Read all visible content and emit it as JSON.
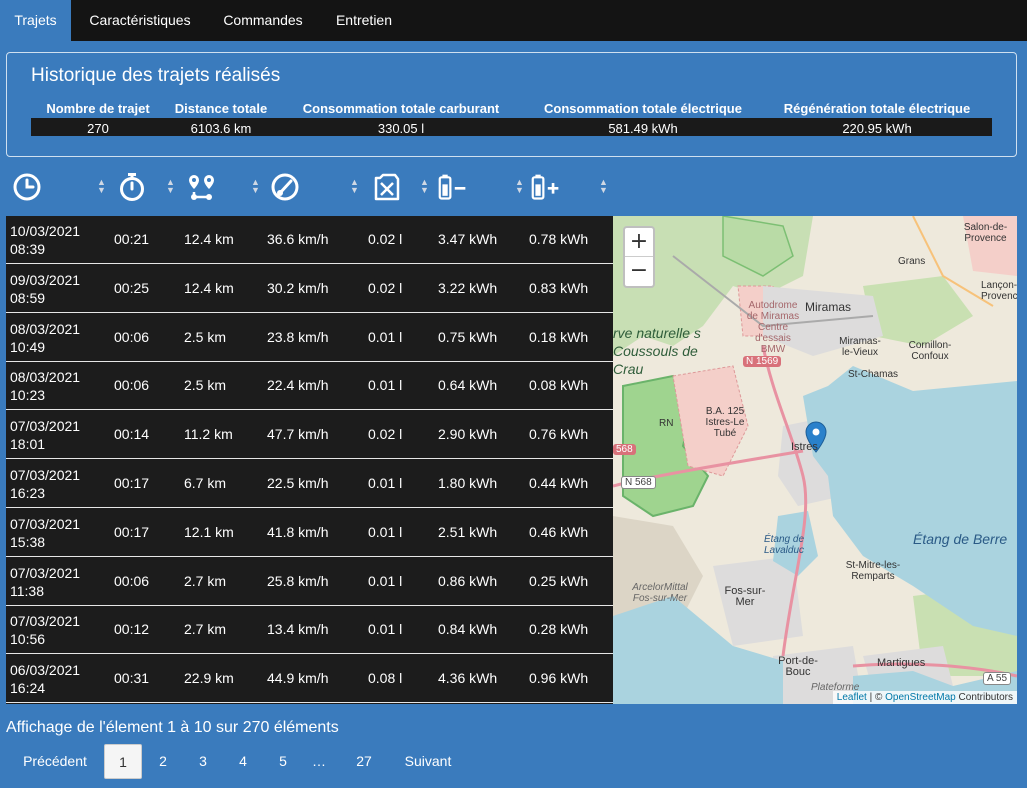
{
  "nav": {
    "tabs": [
      {
        "label": "Trajets",
        "active": true
      },
      {
        "label": "Caractéristiques",
        "active": false
      },
      {
        "label": "Commandes",
        "active": false
      },
      {
        "label": "Entretien",
        "active": false
      }
    ]
  },
  "summary": {
    "title": "Historique des trajets réalisés",
    "headers": [
      "Nombre de trajet",
      "Distance totale",
      "Consommation totale carburant",
      "Consommation totale électrique",
      "Régénération totale électrique"
    ],
    "values": [
      "270",
      "6103.6 km",
      "330.05 l",
      "581.49 kWh",
      "220.95 kWh"
    ]
  },
  "columns": {
    "icons": [
      "clock-icon",
      "stopwatch-icon",
      "route-icon",
      "speedometer-icon",
      "fuel-can-icon",
      "battery-minus-icon",
      "battery-plus-icon"
    ]
  },
  "trips": [
    {
      "date": "10/03/2021",
      "time": "08:39",
      "duration": "00:21",
      "distance": "12.4 km",
      "speed": "36.6 km/h",
      "fuel": "0.02 l",
      "elec": "3.47 kWh",
      "regen": "0.78 kWh"
    },
    {
      "date": "09/03/2021",
      "time": "08:59",
      "duration": "00:25",
      "distance": "12.4 km",
      "speed": "30.2 km/h",
      "fuel": "0.02 l",
      "elec": "3.22 kWh",
      "regen": "0.83 kWh"
    },
    {
      "date": "08/03/2021",
      "time": "10:49",
      "duration": "00:06",
      "distance": "2.5 km",
      "speed": "23.8 km/h",
      "fuel": "0.01 l",
      "elec": "0.75 kWh",
      "regen": "0.18 kWh"
    },
    {
      "date": "08/03/2021",
      "time": "10:23",
      "duration": "00:06",
      "distance": "2.5 km",
      "speed": "22.4 km/h",
      "fuel": "0.01 l",
      "elec": "0.64 kWh",
      "regen": "0.08 kWh"
    },
    {
      "date": "07/03/2021",
      "time": "18:01",
      "duration": "00:14",
      "distance": "11.2 km",
      "speed": "47.7 km/h",
      "fuel": "0.02 l",
      "elec": "2.90 kWh",
      "regen": "0.76 kWh"
    },
    {
      "date": "07/03/2021",
      "time": "16:23",
      "duration": "00:17",
      "distance": "6.7 km",
      "speed": "22.5 km/h",
      "fuel": "0.01 l",
      "elec": "1.80 kWh",
      "regen": "0.44 kWh"
    },
    {
      "date": "07/03/2021",
      "time": "15:38",
      "duration": "00:17",
      "distance": "12.1 km",
      "speed": "41.8 km/h",
      "fuel": "0.01 l",
      "elec": "2.51 kWh",
      "regen": "0.46 kWh"
    },
    {
      "date": "07/03/2021",
      "time": "11:38",
      "duration": "00:06",
      "distance": "2.7 km",
      "speed": "25.8 km/h",
      "fuel": "0.01 l",
      "elec": "0.86 kWh",
      "regen": "0.25 kWh"
    },
    {
      "date": "07/03/2021",
      "time": "10:56",
      "duration": "00:12",
      "distance": "2.7 km",
      "speed": "13.4 km/h",
      "fuel": "0.01 l",
      "elec": "0.84 kWh",
      "regen": "0.28 kWh"
    },
    {
      "date": "06/03/2021",
      "time": "16:24",
      "duration": "00:31",
      "distance": "22.9 km",
      "speed": "44.9 km/h",
      "fuel": "0.08 l",
      "elec": "4.36 kWh",
      "regen": "0.96 kWh"
    }
  ],
  "map": {
    "zoom_in": "+",
    "zoom_out": "−",
    "attribution_leaflet": "Leaflet",
    "attribution_sep": "| ©",
    "attribution_osm": "OpenStreetMap",
    "attribution_contrib": "Contributors",
    "labels": {
      "salon": "Salon-de-Provence",
      "grans": "Grans",
      "lancon": "Lançon-Provence",
      "miramas": "Miramas",
      "autodrome": "Autodrome de Miramas Centre d'essais BMW",
      "reserve": "rve naturelle s Coussouls de Crau",
      "miramas_vieux": "Miramas-le-Vieux",
      "cornillon": "Cornillon-Confoux",
      "st_chamas": "St-Chamas",
      "base": "B.A. 125 Istres-Le Tubé",
      "istres": "Istres",
      "etang_berre": "Étang de Berre",
      "etang_lavalduc": "Étang de Lavalduc",
      "st_mitre": "St-Mitre-les-Remparts",
      "arcelor": "ArcelorMittal Fos-sur-Mer",
      "fos": "Fos-sur-Mer",
      "port_bouc": "Port-de-Bouc",
      "martigues": "Martigues",
      "plateforme": "Plateforme",
      "rn": "RN"
    },
    "roads": {
      "n1569": "N 1569",
      "n568": "N 568",
      "n568b": "568",
      "a55": "A 55"
    },
    "colors": {
      "water": "#aad3df",
      "forest": "#add19e",
      "reserve": "#8fd08a",
      "urban": "#e0dfdf",
      "military": "#f2c4c1",
      "road": "#e892a2"
    }
  },
  "footer": {
    "info": "Affichage de l'élement 1 à 10 sur 270 éléments",
    "prev": "Précédent",
    "pages": [
      "1",
      "2",
      "3",
      "4",
      "5",
      "…",
      "27"
    ],
    "current": "1",
    "next": "Suivant"
  }
}
